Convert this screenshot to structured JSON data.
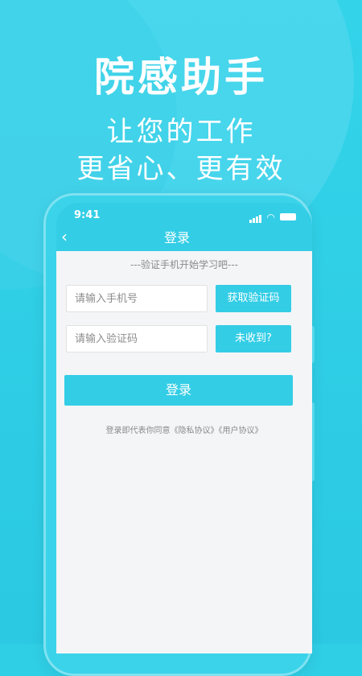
{
  "promo": {
    "title": "院感助手",
    "subtitle_line1": "让您的工作",
    "subtitle_line2": "更省心、更有效"
  },
  "status_bar": {
    "time": "9:41"
  },
  "navbar": {
    "back_icon": "‹",
    "title": "登录"
  },
  "login": {
    "hint": "---验证手机开始学习吧---",
    "phone_placeholder": "请输入手机号",
    "code_placeholder": "请输入验证码",
    "get_code_label": "获取验证码",
    "not_received_label": "未收到?",
    "login_label": "登录",
    "agreement_text": "登录即代表你同意《隐私协议》《用户协议》"
  },
  "colors": {
    "primary": "#33cde6",
    "background": "#f4f5f7",
    "text_gray": "#8a8a8a"
  },
  "icons": [
    "back-icon",
    "signal-icon",
    "wifi-icon",
    "battery-icon"
  ]
}
